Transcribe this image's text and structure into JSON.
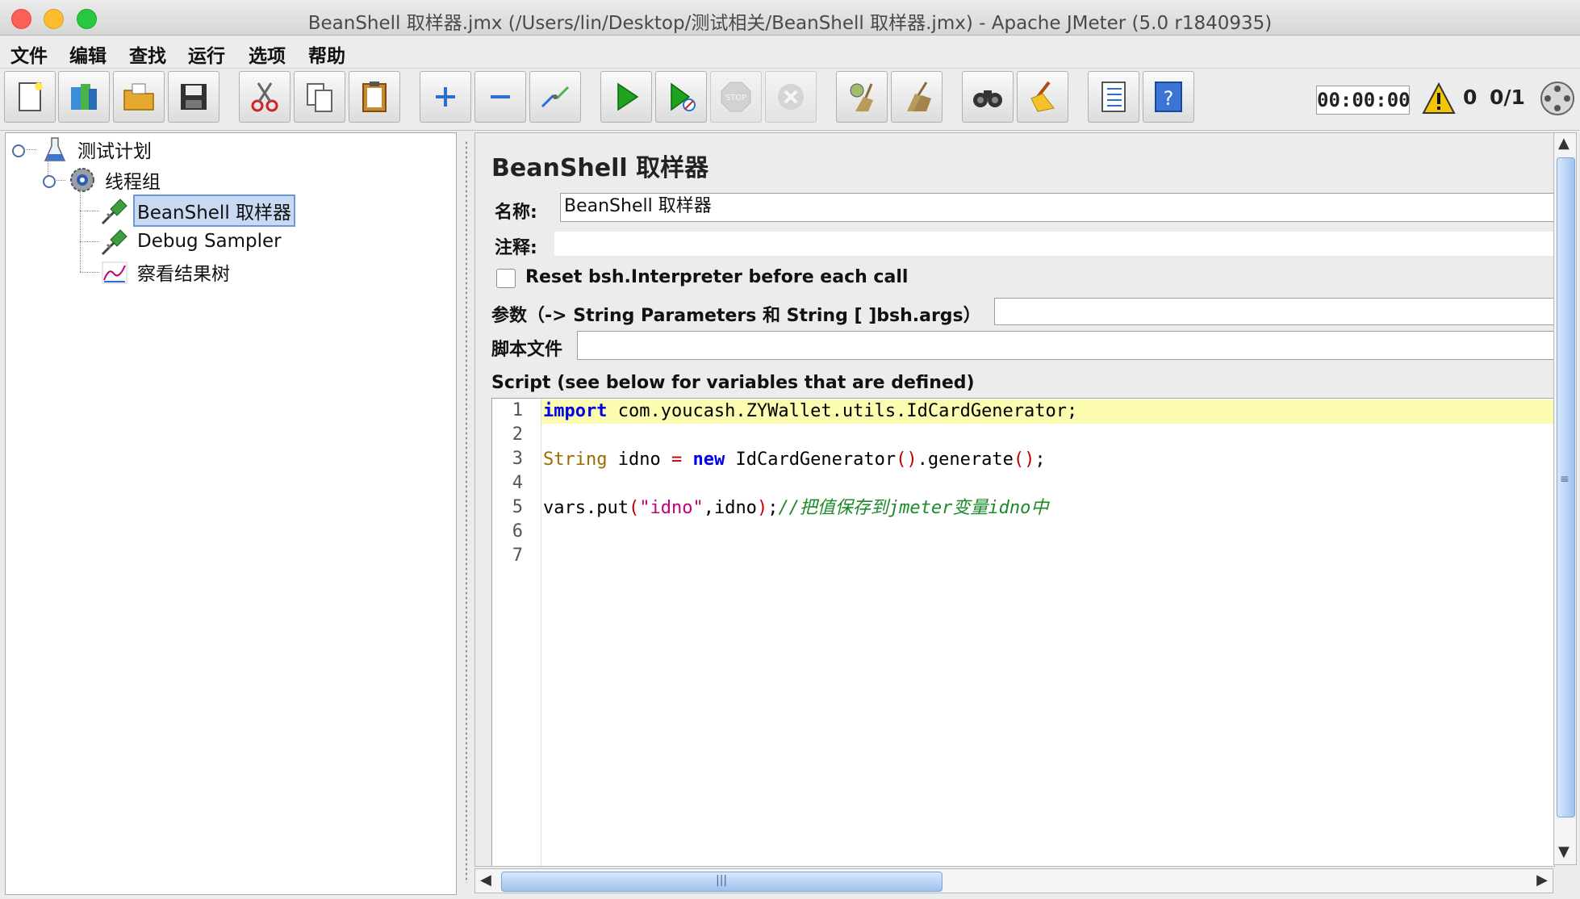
{
  "window": {
    "title": "BeanShell 取样器.jmx (/Users/lin/Desktop/测试相关/BeanShell 取样器.jmx) - Apache JMeter (5.0 r1840935)"
  },
  "menu": [
    "文件",
    "编辑",
    "查找",
    "运行",
    "选项",
    "帮助"
  ],
  "toolbar": {
    "buttons": [
      "new-icon",
      "templates-icon",
      "open-icon",
      "save-icon",
      "cut-icon",
      "copy-icon",
      "paste-icon",
      "expand-icon",
      "collapse-icon",
      "toggle-icon",
      "start-icon",
      "start-no-pause-icon",
      "stop-icon",
      "shutdown-icon",
      "clear-icon",
      "clear-all-icon",
      "search-icon",
      "reset-search-icon",
      "function-helper-icon",
      "help-icon"
    ],
    "timer": "00:00:00",
    "warnings": "0",
    "threads": "0/1"
  },
  "tree": {
    "items": [
      {
        "label": "测试计划",
        "icon": "test-plan-icon"
      },
      {
        "label": "线程组",
        "icon": "thread-group-icon"
      },
      {
        "label": "BeanShell 取样器",
        "icon": "sampler-icon",
        "selected": true
      },
      {
        "label": "Debug Sampler",
        "icon": "sampler-icon"
      },
      {
        "label": "察看结果树",
        "icon": "listener-icon"
      }
    ]
  },
  "panel": {
    "title": "BeanShell 取样器",
    "name_label": "名称:",
    "name_value": "BeanShell 取样器",
    "comment_label": "注释:",
    "reset_label": "Reset bsh.Interpreter before each call",
    "params_label": "参数（-> String Parameters 和 String [ ]bsh.args）",
    "script_file_label": "脚本文件",
    "script_label": "Script (see below for variables that are defined)"
  },
  "editor": {
    "line_numbers": [
      "1",
      "2",
      "3",
      "4",
      "5",
      "6",
      "7"
    ],
    "line1": {
      "kw": "import",
      "rest": " com.youcash.ZYWallet.utils.IdCardGenerator;"
    },
    "line3": {
      "type": "String",
      "a": " idno ",
      "eq": "=",
      "sp": " ",
      "kw": "new",
      "b": " IdCardGenerator",
      "p1": "()",
      "c": ".generate",
      "p2": "()",
      "semi": ";"
    },
    "line5": {
      "a": "vars.put",
      "p1": "(",
      "str": "\"idno\"",
      "b": ",idno",
      "p2": ")",
      "semi": ";",
      "comment": "//把值保存到jmeter变量idno中"
    }
  }
}
